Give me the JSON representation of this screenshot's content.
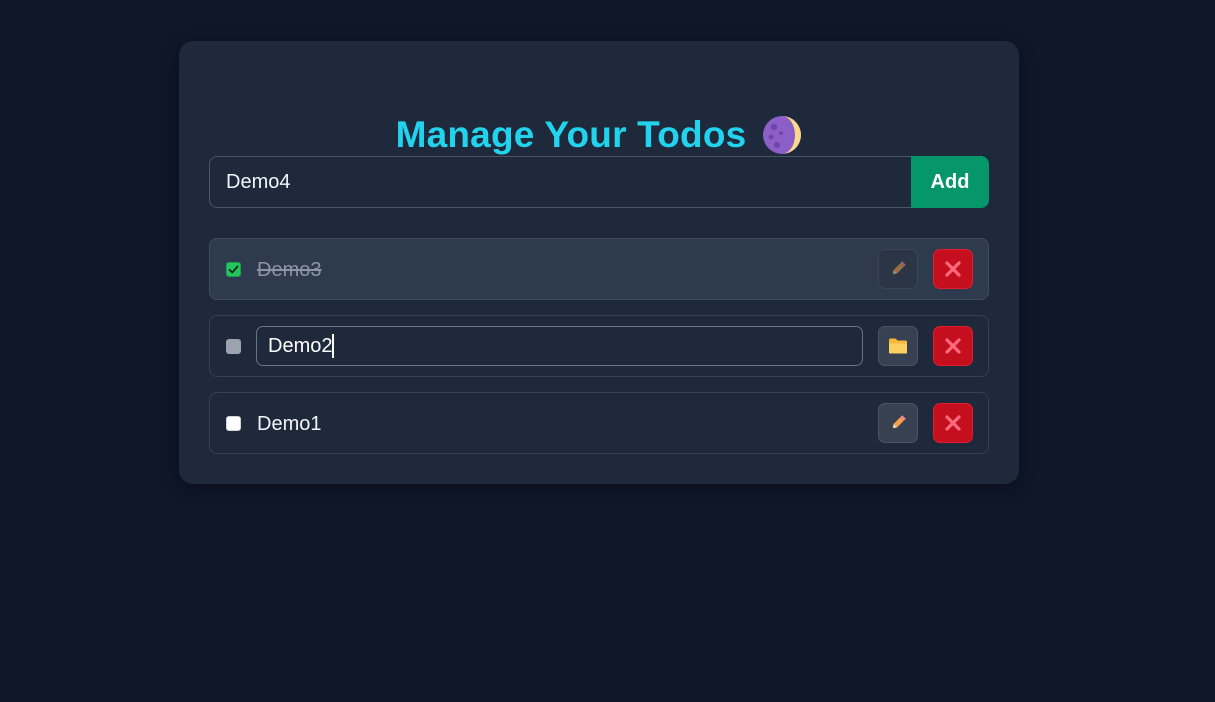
{
  "header": {
    "title": "Manage Your Todos",
    "title_icon": "crescent-moon-icon"
  },
  "add_form": {
    "input_value": "Demo4",
    "add_label": "Add"
  },
  "todos": [
    {
      "text": "Demo3",
      "completed": true,
      "editing": false,
      "actions": [
        "pencil-icon",
        "close-icon"
      ]
    },
    {
      "text": "Demo2",
      "completed": false,
      "editing": true,
      "actions": [
        "folder-icon",
        "close-icon"
      ]
    },
    {
      "text": "Demo1",
      "completed": false,
      "editing": false,
      "actions": [
        "pencil-icon",
        "close-icon"
      ]
    }
  ],
  "colors": {
    "background": "#0f1729",
    "card": "#1e293b",
    "title": "#22d3ee",
    "add_button": "#059669",
    "delete_button": "#c50f1f",
    "checkbox_checked": "#22c55e"
  }
}
